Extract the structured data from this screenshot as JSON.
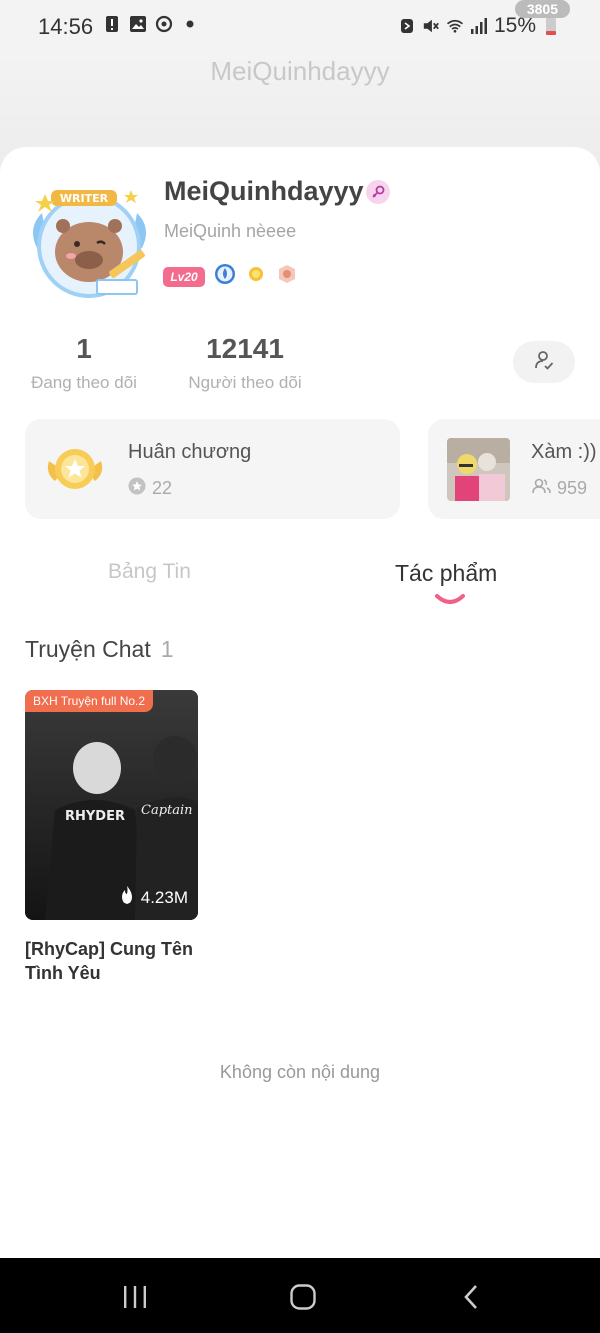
{
  "status_bar": {
    "time": "14:56",
    "battery_pct": "15%",
    "steps": "3805",
    "icons_left": [
      "alert-icon",
      "image-icon",
      "sync-icon",
      "dot-icon"
    ],
    "icons_right": [
      "nfc-icon",
      "mute-icon",
      "wifi-icon",
      "signal-icon",
      "battery-icon"
    ]
  },
  "header": {
    "title": "MeiQuinhdayyy"
  },
  "profile": {
    "name": "MeiQuinhdayyy",
    "bio": "MeiQuinh nèeee",
    "level": "Lv20",
    "avatar_label": "WRITER"
  },
  "stats": {
    "following_count": "1",
    "following_label": "Đang theo dõi",
    "followers_count": "12141",
    "followers_label": "Người theo dõi"
  },
  "features": {
    "medal_title": "Huân chương",
    "medal_count": "22",
    "group_title": "Xàm :))",
    "group_count": "959"
  },
  "tabs": [
    {
      "label": "Bảng Tin",
      "active": false
    },
    {
      "label": "Tác phẩm",
      "active": true
    }
  ],
  "section": {
    "title": "Truyện Chat",
    "count": "1"
  },
  "story": {
    "rank": "BXH Truyện full No.2",
    "views": "4.23M",
    "title": "[RhyCap] Cung Tên Tình Yêu",
    "cover_text_left": "RHYDER",
    "cover_text_right": "Captain"
  },
  "end_message": "Không còn nội dung",
  "colors": {
    "accent": "#f36b8d",
    "rank_tag": "#f06d4e"
  }
}
